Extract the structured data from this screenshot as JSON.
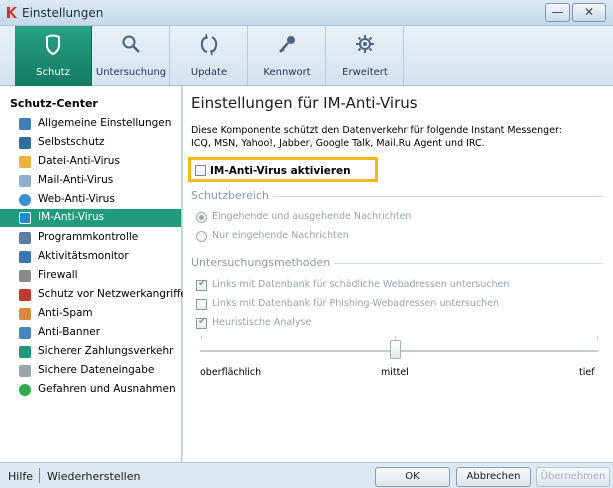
{
  "window": {
    "title": "Einstellungen",
    "minimize_label": "—",
    "close_label": "✕"
  },
  "tabs": [
    {
      "label": "Schutz",
      "icon": "shield-icon"
    },
    {
      "label": "Untersuchung",
      "icon": "magnifier-icon"
    },
    {
      "label": "Update",
      "icon": "refresh-icon"
    },
    {
      "label": "Kennwort",
      "icon": "key-icon"
    },
    {
      "label": "Erweitert",
      "icon": "gear-icon"
    }
  ],
  "sidebar": {
    "title": "Schutz-Center",
    "items": [
      {
        "label": "Allgemeine Einstellungen",
        "color": "#3d7fb8"
      },
      {
        "label": "Selbstschutz",
        "color": "#2f6b9c"
      },
      {
        "label": "Datei-Anti-Virus",
        "color": "#e9b53a"
      },
      {
        "label": "Mail-Anti-Virus",
        "color": "#8fb0cc"
      },
      {
        "label": "Web-Anti-Virus",
        "color": "#3b8fd1"
      },
      {
        "label": "IM-Anti-Virus",
        "color": "#1a8bd6"
      },
      {
        "label": "Programmkontrolle",
        "color": "#5b7fa3"
      },
      {
        "label": "Aktivitätsmonitor",
        "color": "#3a76b0"
      },
      {
        "label": "Firewall",
        "color": "#8a8a8a"
      },
      {
        "label": "Schutz vor Netzwerkangriffen",
        "color": "#c0392b"
      },
      {
        "label": "Anti-Spam",
        "color": "#d98a3d"
      },
      {
        "label": "Anti-Banner",
        "color": "#4c84c2"
      },
      {
        "label": "Sicherer Zahlungsverkehr",
        "color": "#1f9b7c"
      },
      {
        "label": "Sichere Dateneingabe",
        "color": "#9aa5ae"
      },
      {
        "label": "Gefahren und Ausnahmen",
        "color": "#2eab4a"
      }
    ],
    "selected_index": 5
  },
  "main": {
    "title": "Einstellungen für IM-Anti-Virus",
    "description_line1": "Diese Komponente schützt den Datenverkehr für folgende Instant Messenger:",
    "description_line2": "ICQ, MSN, Yahoo!, Jabber, Google Talk, Mail.Ru Agent und IRC.",
    "activate_label": "IM-Anti-Virus aktivieren",
    "activate_checked": false,
    "scope": {
      "title": "Schutzbereich",
      "options": [
        {
          "label": "Eingehende und ausgehende Nachrichten",
          "selected": true
        },
        {
          "label": "Nur eingehende Nachrichten",
          "selected": false
        }
      ]
    },
    "methods": {
      "title": "Untersuchungsmethoden",
      "options": [
        {
          "label": "Links mit Datenbank für schädliche Webadressen untersuchen",
          "checked": true
        },
        {
          "label": "Links mit Datenbank für Phishing-Webadressen untersuchen",
          "checked": false
        },
        {
          "label": "Heuristische Analyse",
          "checked": true
        }
      ]
    },
    "slider": {
      "labels": [
        "oberflächlich",
        "mittel",
        "tief"
      ],
      "value": "mittel"
    }
  },
  "footer": {
    "help": "Hilfe",
    "restore": "Wiederherstellen",
    "ok": "OK",
    "cancel": "Abbrechen",
    "apply": "Übernehmen"
  }
}
